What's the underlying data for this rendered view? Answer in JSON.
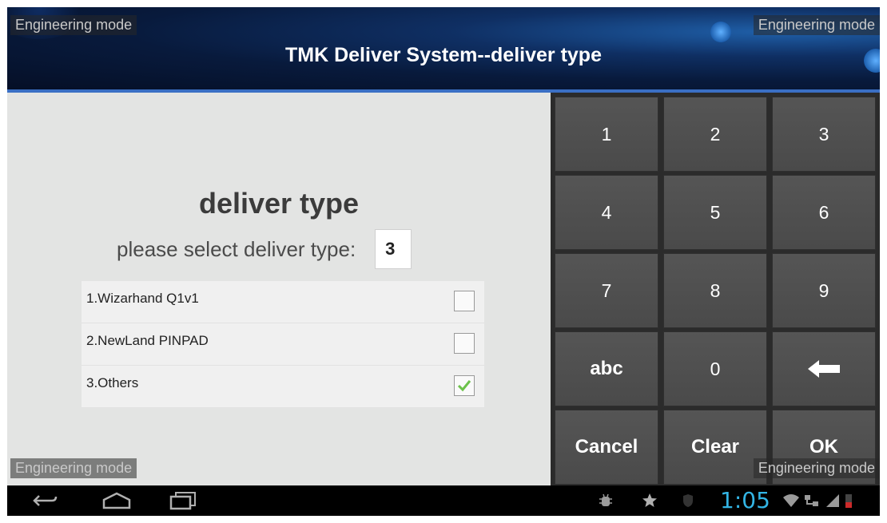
{
  "watermark": "Engineering mode",
  "header": {
    "title": "TMK Deliver System--deliver type"
  },
  "form": {
    "title": "deliver type",
    "prompt": "please select deliver type:",
    "input_value": "3",
    "options": [
      {
        "label": "1.Wizarhand Q1v1",
        "checked": false
      },
      {
        "label": "2.NewLand PINPAD",
        "checked": false
      },
      {
        "label": "3.Others",
        "checked": true
      }
    ]
  },
  "keypad": {
    "keys": [
      "1",
      "2",
      "3",
      "4",
      "5",
      "6",
      "7",
      "8",
      "9",
      "abc",
      "0",
      "backspace-icon",
      "Cancel",
      "Clear",
      "OK"
    ]
  },
  "statusbar": {
    "time": "1:05"
  },
  "colors": {
    "accent": "#33b5e5",
    "check": "#6cc24a",
    "header_dark": "#081a3c"
  }
}
